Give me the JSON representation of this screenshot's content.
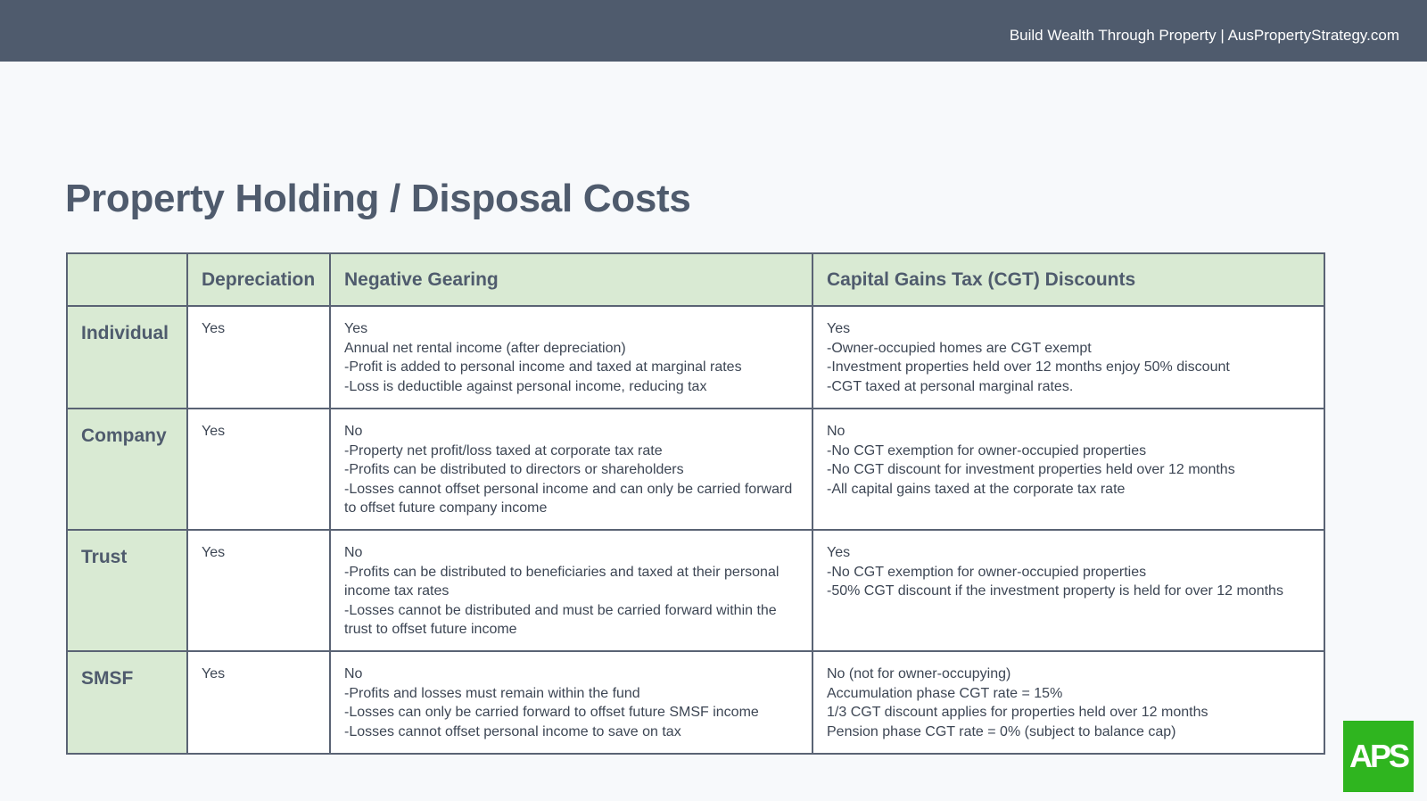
{
  "header": {
    "tagline": "Build Wealth Through Property | AusPropertyStrategy.com"
  },
  "title": "Property Holding / Disposal Costs",
  "table": {
    "columns": [
      "",
      "Depreciation",
      "Negative Gearing",
      "Capital Gains Tax (CGT) Discounts"
    ],
    "rows": [
      {
        "entity": "Individual",
        "depreciation": "Yes",
        "negative_gearing": [
          "Yes",
          "Annual net rental income (after depreciation)",
          "-Profit is added to personal income and taxed at marginal rates",
          "-Loss is deductible against personal income, reducing tax"
        ],
        "cgt": [
          "Yes",
          "-Owner-occupied homes are CGT exempt",
          "-Investment properties held over 12 months enjoy 50% discount",
          "-CGT taxed at personal marginal rates."
        ]
      },
      {
        "entity": "Company",
        "depreciation": "Yes",
        "negative_gearing": [
          "No",
          "-Property net profit/loss taxed at corporate tax rate",
          "-Profits can be distributed to directors or shareholders",
          "-Losses cannot offset personal income and can only be carried forward to offset future company income"
        ],
        "cgt": [
          "No",
          "-No CGT exemption for owner-occupied properties",
          "-No CGT discount for investment properties held over 12 months",
          "-All capital gains taxed at the corporate tax rate"
        ]
      },
      {
        "entity": "Trust",
        "depreciation": "Yes",
        "negative_gearing": [
          "No",
          "-Profits can be distributed to beneficiaries and taxed at their personal income tax rates",
          "-Losses cannot be distributed and must be carried forward within the trust to offset future income"
        ],
        "cgt": [
          "Yes",
          "-No CGT exemption for owner-occupied properties",
          "-50% CGT discount if the investment property is held for over 12 months"
        ]
      },
      {
        "entity": "SMSF",
        "depreciation": "Yes",
        "negative_gearing": [
          "No",
          "-Profits and losses must remain within the fund",
          "-Losses can only be carried forward to offset future SMSF income",
          "-Losses cannot offset personal income to save on tax"
        ],
        "cgt": [
          "No (not for owner-occupying)",
          "Accumulation phase CGT rate = 15%",
          "1/3 CGT discount applies for properties held over 12 months",
          "Pension phase CGT rate = 0% (subject to balance cap)"
        ]
      }
    ]
  },
  "logo": {
    "text": "APS",
    "color": "#2fb51f"
  },
  "colors": {
    "header_bg": "#4f5b6d",
    "table_header_bg": "#d9ead3",
    "border": "#5a6374"
  }
}
